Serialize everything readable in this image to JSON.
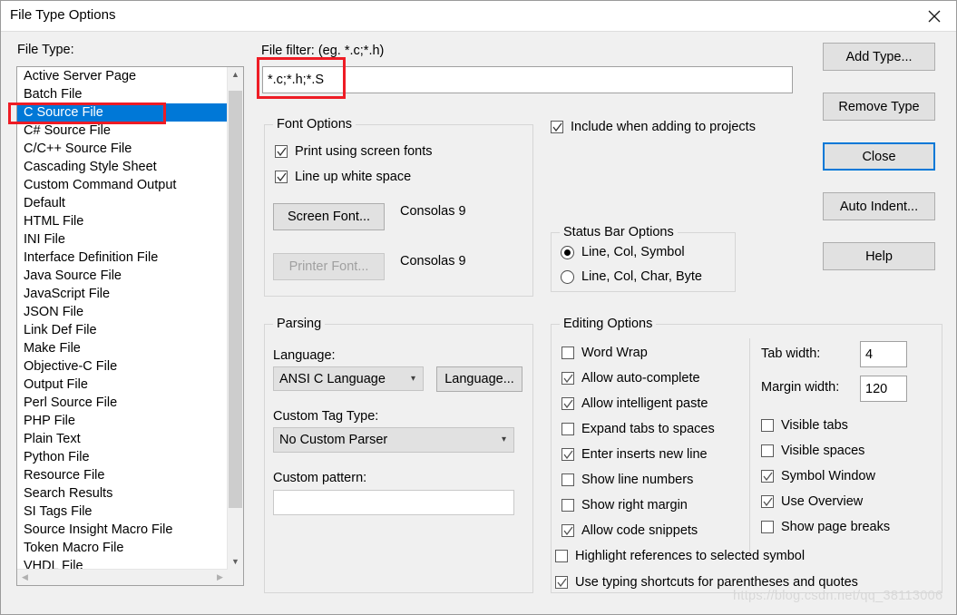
{
  "window": {
    "title": "File Type Options",
    "close_icon": "close-icon"
  },
  "filetype": {
    "label": "File Type:",
    "items": [
      "Active Server Page",
      "Batch File",
      "C Source File",
      "C# Source File",
      "C/C++ Source File",
      "Cascading Style Sheet",
      "Custom Command Output",
      "Default",
      "HTML File",
      "INI File",
      "Interface Definition File",
      "Java Source File",
      "JavaScript File",
      "JSON File",
      "Link Def File",
      "Make File",
      "Objective-C File",
      "Output File",
      "Perl Source File",
      "PHP File",
      "Plain Text",
      "Python File",
      "Resource File",
      "Search Results",
      "SI Tags File",
      "Source Insight Macro File",
      "Token Macro File",
      "VHDL File"
    ],
    "selected": "C Source File",
    "selected_index": 2,
    "scroll_up_icon": "chevron-up-icon",
    "scroll_down_icon": "chevron-down-icon",
    "scroll_left_icon": "chevron-left-icon",
    "scroll_right_icon": "chevron-right-icon"
  },
  "filter": {
    "label": "File filter: (eg. *.c;*.h)",
    "value": "*.c;*.h;*.S"
  },
  "font_options": {
    "title": "Font Options",
    "print_using_screen_fonts": {
      "label": "Print using screen fonts",
      "checked": true
    },
    "line_up_white_space": {
      "label": "Line up white space",
      "checked": true
    },
    "screen_font_button": "Screen Font...",
    "screen_font_value": "Consolas 9",
    "printer_font_button": "Printer Font...",
    "printer_font_value": "Consolas 9"
  },
  "include_projects": {
    "label": "Include when adding to projects",
    "checked": true
  },
  "status_bar": {
    "title": "Status Bar Options",
    "options": [
      {
        "label": "Line, Col, Symbol",
        "selected": true
      },
      {
        "label": "Line, Col, Char, Byte",
        "selected": false
      }
    ]
  },
  "parsing": {
    "title": "Parsing",
    "language_label": "Language:",
    "language_value": "ANSI C Language",
    "language_button": "Language...",
    "custom_tag_label": "Custom Tag Type:",
    "custom_tag_value": "No Custom Parser",
    "custom_pattern_label": "Custom pattern:",
    "custom_pattern_value": ""
  },
  "editing": {
    "title": "Editing Options",
    "left_checks": [
      {
        "label": "Word Wrap",
        "checked": false
      },
      {
        "label": "Allow auto-complete",
        "checked": true
      },
      {
        "label": "Allow intelligent paste",
        "checked": true
      },
      {
        "label": "Expand tabs to spaces",
        "checked": false
      },
      {
        "label": "Enter inserts new line",
        "checked": true
      },
      {
        "label": "Show line numbers",
        "checked": false
      },
      {
        "label": "Show right margin",
        "checked": false
      },
      {
        "label": "Allow code snippets",
        "checked": true
      }
    ],
    "wide_checks": [
      {
        "label": "Highlight references to selected symbol",
        "checked": false
      },
      {
        "label": "Use typing shortcuts for parentheses and quotes",
        "checked": true
      }
    ],
    "tab_width_label": "Tab width:",
    "tab_width_value": "4",
    "margin_width_label": "Margin width:",
    "margin_width_value": "120",
    "right_checks": [
      {
        "label": "Visible tabs",
        "checked": false
      },
      {
        "label": "Visible spaces",
        "checked": false
      },
      {
        "label": "Symbol Window",
        "checked": true
      },
      {
        "label": "Use Overview",
        "checked": true
      },
      {
        "label": "Show page breaks",
        "checked": false
      }
    ]
  },
  "buttons": {
    "add_type": "Add Type...",
    "remove_type": "Remove Type",
    "close": "Close",
    "auto_indent": "Auto Indent...",
    "help": "Help"
  },
  "watermark": "https://blog.csdn.net/qq_38113006",
  "colors": {
    "selection": "#0078d7",
    "annotation": "#ee1c25",
    "dialog_bg": "#f0f0f0"
  }
}
